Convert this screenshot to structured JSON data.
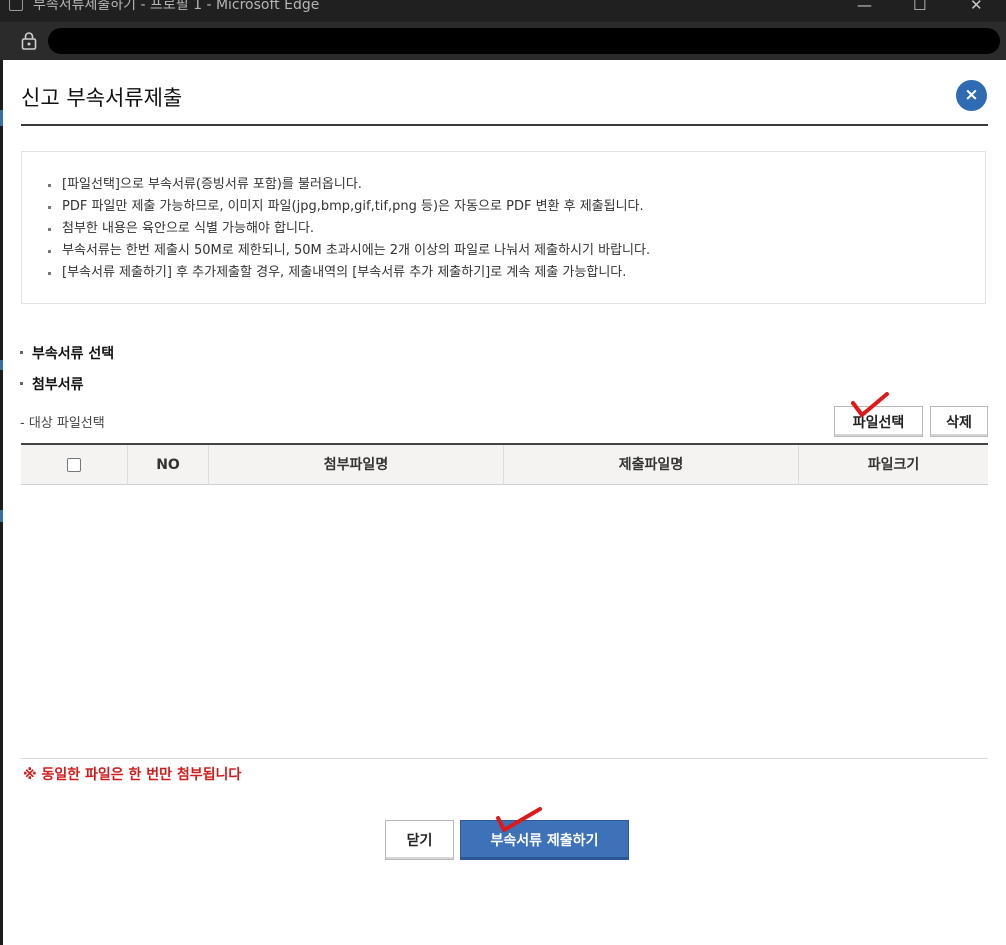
{
  "browser": {
    "window_title": "부속서류제출하기 - 프로필 1 - Microsoft Edge",
    "minimize_glyph": "—",
    "maximize_glyph": "☐",
    "close_glyph": "✕",
    "lock_icon": "lock-icon"
  },
  "dialog": {
    "title": "신고 부속서류제출",
    "close_glyph": "×",
    "close_icon": "close-icon",
    "accent_color": "#2f6bb3"
  },
  "info": {
    "items": [
      "[파일선택]으로 부속서류(증빙서류 포함)를 불러옵니다.",
      "PDF 파일만 제출 가능하므로, 이미지 파일(jpg,bmp,gif,tif,png 등)은 자동으로 PDF 변환 후 제출됩니다.",
      "첨부한 내용은 육안으로 식별 가능해야 합니다.",
      "부속서류는 한번 제출시 50M로 제한되니, 50M 초과시에는 2개 이상의 파일로 나눠서 제출하시기 바랍니다.",
      "[부속서류 제출하기] 후 추가제출할 경우, 제출내역의 [부속서류 추가 제출하기]로 계속 제출 가능합니다."
    ]
  },
  "sections": {
    "select_title": "부속서류 선택",
    "attach_title": "첨부서류",
    "target_label": "- 대상 파일선택"
  },
  "buttons": {
    "select_file": "파일선택",
    "delete": "삭제",
    "close": "닫기",
    "submit": "부속서류 제출하기"
  },
  "table": {
    "columns": [
      "NO",
      "첨부파일명",
      "제출파일명",
      "파일크기"
    ],
    "rows": []
  },
  "notice": {
    "text": "※ 동일한 파일은 한 번만 첨부됩니다",
    "color": "#d21c1c"
  },
  "annotations": {
    "mark_icon": "red-checkmark-icon",
    "mark_color": "#e01818"
  }
}
